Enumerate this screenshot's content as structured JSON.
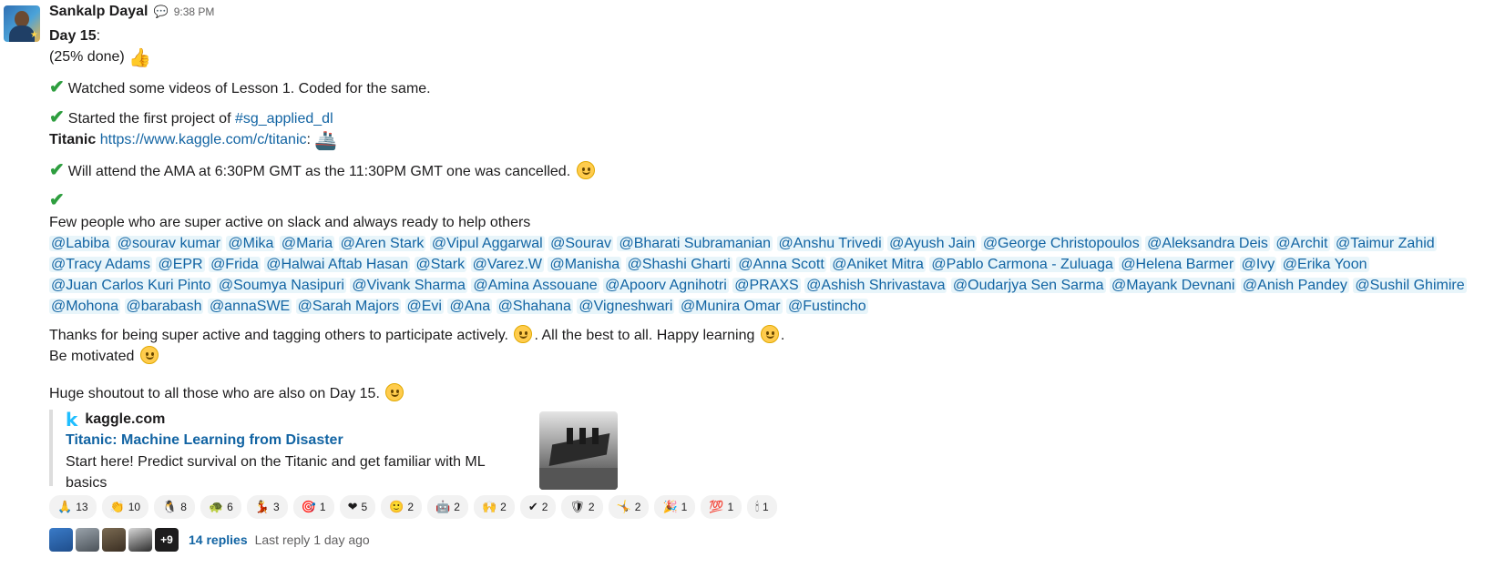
{
  "message": {
    "sender": "Sankalp Dayal",
    "status_icon": "💬",
    "time": "9:38 PM",
    "day_label": "Day 15",
    "day_suffix": ":",
    "progress": "(25% done)",
    "thumbs_emoji": "👍",
    "item1": "Watched some videos of Lesson 1. Coded for the same.",
    "item2_prefix": "Started the first project of ",
    "channel": "#sg_applied_dl",
    "titanic_label": "Titanic",
    "titanic_url": "https://www.kaggle.com/c/titanic",
    "titanic_colon": ":",
    "ship_emoji": "🚢",
    "item3": "Will attend the AMA at 6:30PM GMT as the 11:30PM GMT one was cancelled.",
    "check": "✔",
    "few_people": "Few people who are super active on slack and always ready to help others",
    "mentions": [
      "@Labiba",
      "@sourav kumar",
      "@Mika",
      "@Maria",
      "@Aren Stark",
      "@Vipul Aggarwal",
      "@Sourav",
      "@Bharati Subramanian",
      "@Anshu Trivedi",
      "@Ayush Jain",
      "@George Christopoulos",
      "@Aleksandra Deis",
      "@Archit",
      "@Taimur Zahid",
      "@Tracy Adams",
      "@EPR",
      "@Frida",
      "@Halwai Aftab Hasan",
      "@Stark",
      "@Varez.W",
      "@Manisha",
      "@Shashi Gharti",
      "@Anna Scott",
      "@Aniket Mitra",
      "@Pablo Carmona - Zuluaga",
      "@Helena Barmer",
      "@Ivy",
      "@Erika Yoon",
      "@Juan Carlos Kuri Pinto",
      "@Soumya Nasipuri",
      "@Vivank Sharma",
      "@Amina Assouane",
      "@Apoorv Agnihotri",
      "@PRAXS",
      "@Ashish Shrivastava",
      "@Oudarjya Sen Sarma",
      "@Mayank Devnani",
      "@Anish Pandey",
      "@Sushil Ghimire",
      "@Mohona",
      "@barabash",
      "@annaSWE",
      "@Sarah Majors",
      "@Evi",
      "@Ana",
      "@Shahana",
      "@Vigneshwari",
      "@Munira Omar",
      "@Fustincho"
    ],
    "thanks_part1": "Thanks for being super active and tagging others to participate actively.",
    "thanks_part2": ". All the best to all. Happy learning",
    "thanks_end": ".",
    "motivated": "Be motivated",
    "shoutout": "Huge shoutout to all those who are also on Day 15."
  },
  "unfurl": {
    "site_logo": "k",
    "site": "kaggle.com",
    "title": "Titanic: Machine Learning from Disaster",
    "description": "Start here! Predict survival on the Titanic and get familiar with ML basics"
  },
  "reactions": [
    {
      "icon": "🙏",
      "count": "13"
    },
    {
      "icon": "👏",
      "count": "10"
    },
    {
      "icon": "🐧",
      "count": "8"
    },
    {
      "icon": "🐢",
      "count": "6"
    },
    {
      "icon": "💃",
      "count": "3"
    },
    {
      "icon": "🎯",
      "count": "1"
    },
    {
      "icon": "❤",
      "count": "5"
    },
    {
      "icon": "🙂",
      "count": "2"
    },
    {
      "icon": "🤖",
      "count": "2"
    },
    {
      "icon": "🙌",
      "count": "2"
    },
    {
      "icon": "✔",
      "count": "2"
    },
    {
      "icon": "🛡",
      "count": "2"
    },
    {
      "icon": "🤸",
      "count": "2"
    },
    {
      "icon": "🎉",
      "count": "1"
    },
    {
      "icon": "💯",
      "count": "1"
    },
    {
      "icon": "🕯",
      "count": "1"
    }
  ],
  "reaction_icon_names": [
    "thank-you-icon",
    "clap-icon",
    "penguin-icon",
    "turtle-icon",
    "dancer-icon",
    "target-icon",
    "heart-icon",
    "smile-icon",
    "robot-icon",
    "raised-hands-icon",
    "check-icon",
    "shield-icon",
    "gymnast-icon",
    "party-icon",
    "hundred-icon",
    "candle-icon"
  ],
  "colors": {
    "link": "#1264a3",
    "mention_bg": "#e8f5fa",
    "check": "#2e9e3f",
    "reaction_bg": "#f2f2f2"
  },
  "thread": {
    "more_count": "+9",
    "replies": "14 replies",
    "last_reply": "Last reply 1 day ago"
  }
}
